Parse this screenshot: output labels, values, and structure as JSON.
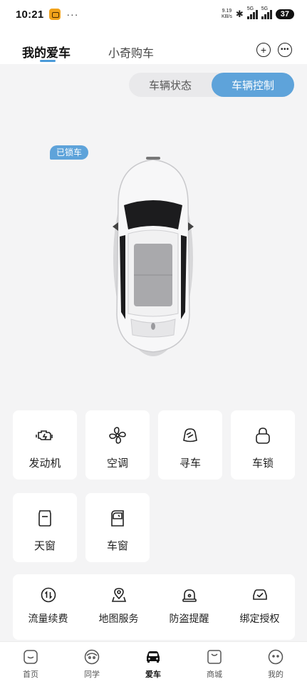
{
  "status_bar": {
    "time": "10:21",
    "speed_value": "9.19",
    "speed_unit": "KB/s",
    "sim1_label": "5G",
    "sim2_label": "5G",
    "battery": "37"
  },
  "header": {
    "tabs": [
      {
        "label": "我的爱车",
        "active": true
      },
      {
        "label": "小奇购车",
        "active": false
      }
    ]
  },
  "segment": {
    "status_label": "车辆状态",
    "control_label": "车辆控制",
    "active": "车辆控制"
  },
  "car": {
    "lock_status": "已锁车"
  },
  "controls": [
    {
      "label": "发动机",
      "icon": "engine-icon"
    },
    {
      "label": "空调",
      "icon": "fan-icon"
    },
    {
      "label": "寻车",
      "icon": "find-car-icon"
    },
    {
      "label": "车锁",
      "icon": "lock-icon"
    },
    {
      "label": "天窗",
      "icon": "sunroof-icon"
    },
    {
      "label": "车窗",
      "icon": "car-window-icon"
    }
  ],
  "services": [
    {
      "label": "流量续费",
      "icon": "data-renew-icon"
    },
    {
      "label": "地图服务",
      "icon": "map-pin-icon"
    },
    {
      "label": "防盗提醒",
      "icon": "alarm-icon"
    },
    {
      "label": "绑定授权",
      "icon": "car-auth-icon"
    }
  ],
  "bottom_nav": [
    {
      "label": "首页",
      "icon": "home-icon",
      "active": false
    },
    {
      "label": "同学",
      "icon": "friends-icon",
      "active": false
    },
    {
      "label": "爱车",
      "icon": "car-icon",
      "active": true
    },
    {
      "label": "商城",
      "icon": "mall-icon",
      "active": false
    },
    {
      "label": "我的",
      "icon": "profile-icon",
      "active": false
    }
  ],
  "colors": {
    "accent": "#5ea3da",
    "background": "#f4f4f5",
    "card": "#ffffff"
  }
}
